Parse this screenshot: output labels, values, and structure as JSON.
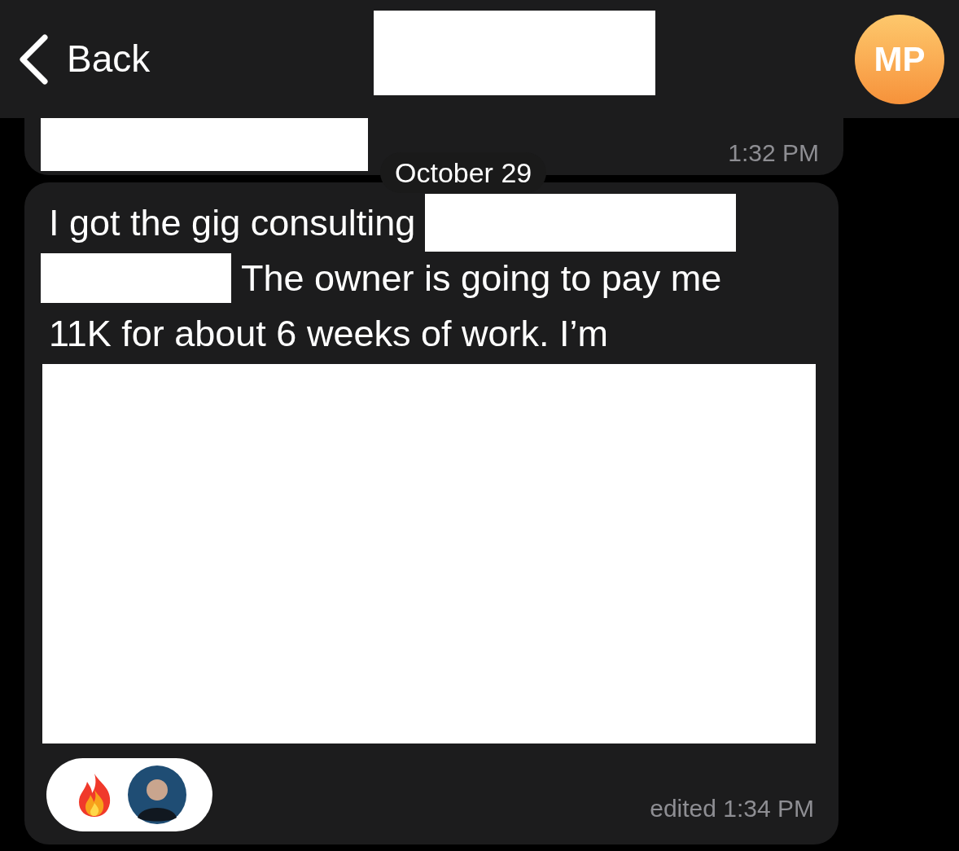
{
  "header": {
    "back_label": "Back",
    "avatar_initials": "MP"
  },
  "previous_message": {
    "time": "1:32 PM"
  },
  "date_separator": "October 29",
  "message": {
    "lines": [
      [
        {
          "kind": "text",
          "text": "I got the gig consulting"
        },
        {
          "kind": "redaction"
        }
      ],
      [
        {
          "kind": "redaction"
        },
        {
          "kind": "text",
          "text": "The owner is going to pay me"
        }
      ],
      [
        {
          "kind": "text",
          "text": "11K for about 6 weeks of work. I’m"
        }
      ]
    ],
    "reactions": [
      {
        "kind": "fire"
      }
    ],
    "time": "edited 1:34 PM"
  }
}
